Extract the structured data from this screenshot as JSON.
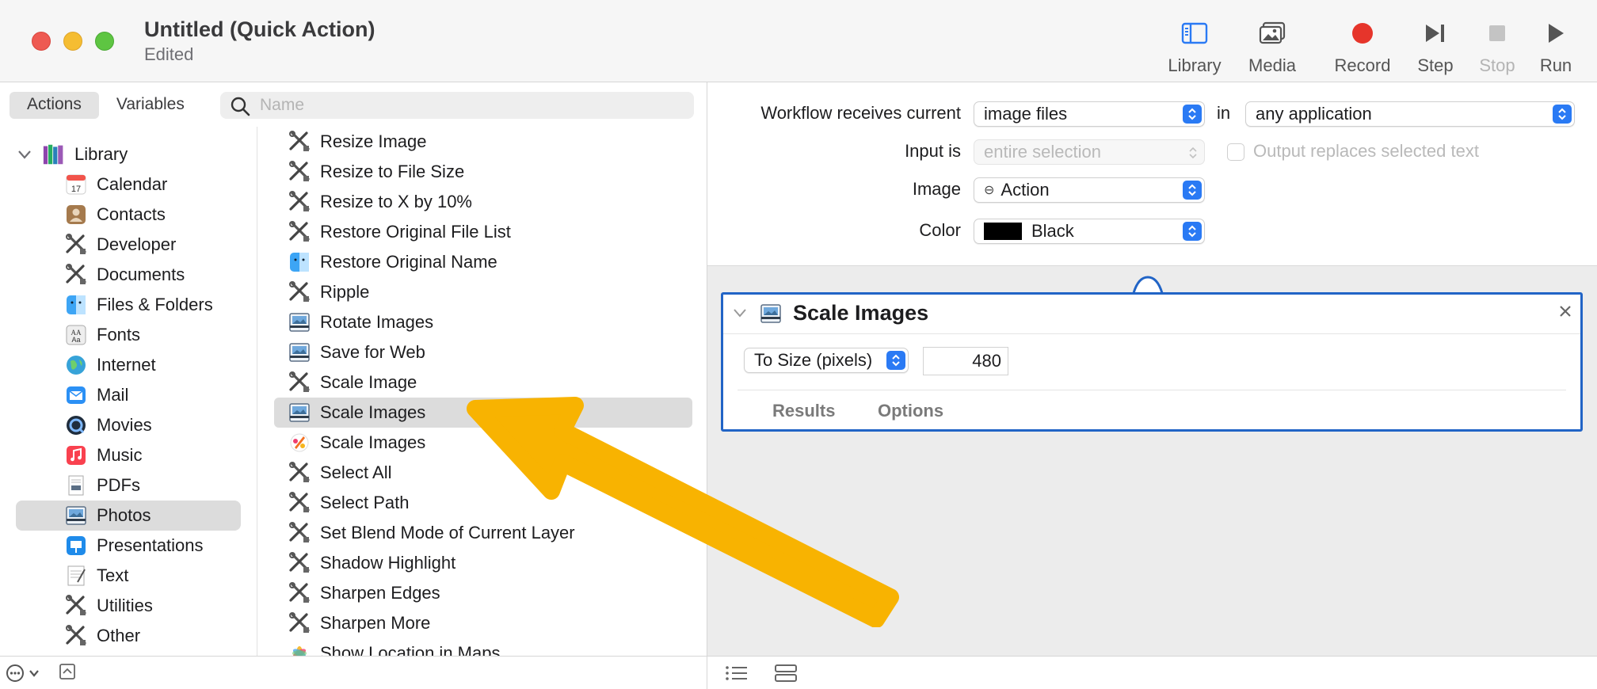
{
  "window": {
    "title": "Untitled (Quick Action)",
    "subtitle": "Edited"
  },
  "toolbar": {
    "library": "Library",
    "media": "Media",
    "record": "Record",
    "step": "Step",
    "stop": "Stop",
    "run": "Run"
  },
  "left_tabs": {
    "actions": "Actions",
    "variables": "Variables"
  },
  "search": {
    "placeholder": "Name"
  },
  "library": {
    "root": "Library",
    "items": [
      {
        "label": "Calendar",
        "icon": "calendar-icon"
      },
      {
        "label": "Contacts",
        "icon": "contacts-icon"
      },
      {
        "label": "Developer",
        "icon": "automator-tools-icon"
      },
      {
        "label": "Documents",
        "icon": "automator-tools-icon"
      },
      {
        "label": "Files & Folders",
        "icon": "finder-icon"
      },
      {
        "label": "Fonts",
        "icon": "fonts-icon"
      },
      {
        "label": "Internet",
        "icon": "globe-icon"
      },
      {
        "label": "Mail",
        "icon": "mail-icon"
      },
      {
        "label": "Movies",
        "icon": "quicktime-icon"
      },
      {
        "label": "Music",
        "icon": "music-icon"
      },
      {
        "label": "PDFs",
        "icon": "pdf-icon"
      },
      {
        "label": "Photos",
        "icon": "preview-icon"
      },
      {
        "label": "Presentations",
        "icon": "keynote-icon"
      },
      {
        "label": "Text",
        "icon": "text-edit-icon"
      },
      {
        "label": "Utilities",
        "icon": "automator-tools-icon"
      },
      {
        "label": "Other",
        "icon": "automator-tools-icon"
      }
    ],
    "selected": "Photos"
  },
  "actions": {
    "items": [
      {
        "label": "Resize Image",
        "icon": "automator-tools-icon"
      },
      {
        "label": "Resize to File Size",
        "icon": "automator-tools-icon"
      },
      {
        "label": "Resize to X by 10%",
        "icon": "automator-tools-icon"
      },
      {
        "label": "Restore Original File List",
        "icon": "automator-tools-icon"
      },
      {
        "label": "Restore Original Name",
        "icon": "finder-icon"
      },
      {
        "label": "Ripple",
        "icon": "automator-tools-icon"
      },
      {
        "label": "Rotate Images",
        "icon": "preview-icon"
      },
      {
        "label": "Save for Web",
        "icon": "preview-icon"
      },
      {
        "label": "Scale Image",
        "icon": "automator-tools-icon"
      },
      {
        "label": "Scale Images",
        "icon": "preview-icon"
      },
      {
        "label": "Scale Images",
        "icon": "pixelmator-icon"
      },
      {
        "label": "Select All",
        "icon": "automator-tools-icon"
      },
      {
        "label": "Select Path",
        "icon": "automator-tools-icon"
      },
      {
        "label": "Set Blend Mode of Current Layer",
        "icon": "automator-tools-icon"
      },
      {
        "label": "Shadow Highlight",
        "icon": "automator-tools-icon"
      },
      {
        "label": "Sharpen Edges",
        "icon": "automator-tools-icon"
      },
      {
        "label": "Sharpen More",
        "icon": "automator-tools-icon"
      },
      {
        "label": "Show Location in Maps",
        "icon": "photos-icon"
      }
    ],
    "selected_index": 9
  },
  "workflow": {
    "receives_label": "Workflow receives current",
    "receives_value": "image files",
    "in_label": "in",
    "app_value": "any application",
    "input_label": "Input is",
    "input_value": "entire selection",
    "output_label": "Output replaces selected text",
    "image_label": "Image",
    "image_value": "Action",
    "color_label": "Color",
    "color_value": "Black",
    "color_swatch": "#000000"
  },
  "action_card": {
    "title": "Scale Images",
    "mode": "To Size (pixels)",
    "size": "480",
    "tab_results": "Results",
    "tab_options": "Options"
  },
  "colors": {
    "accent": "#2a7af4",
    "card_border": "#2164c6",
    "record": "#e6352b",
    "arrow": "#f8b301"
  }
}
